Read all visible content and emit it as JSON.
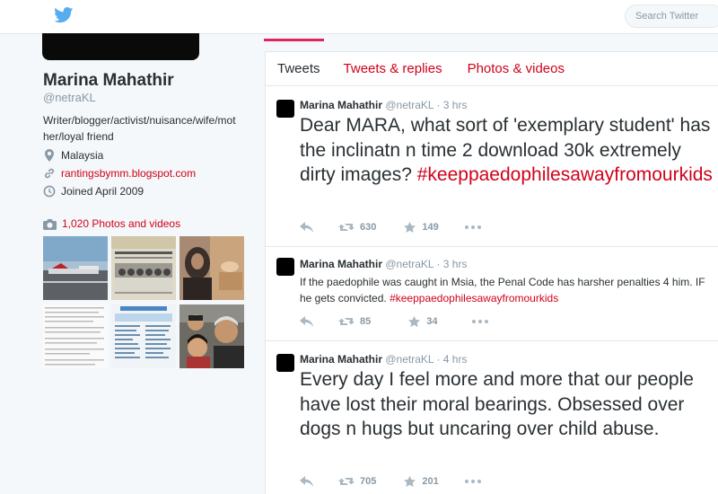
{
  "search": {
    "placeholder": "Search Twitter"
  },
  "profile": {
    "name": "Marina Mahathir",
    "handle": "@netraKL",
    "bio": "Writer/blogger/activist/nuisance/wife/mother/loyal friend",
    "location": "Malaysia",
    "url": "rantingsbymm.blogspot.com",
    "joined": "Joined April 2009",
    "photos_label": "1,020 Photos and videos"
  },
  "tabs": [
    {
      "label": "Tweets"
    },
    {
      "label": "Tweets & replies"
    },
    {
      "label": "Photos & videos"
    }
  ],
  "tweets": [
    {
      "name": "Marina Mahathir",
      "handle": "@netraKL",
      "time": "· 3 hrs",
      "text": "Dear MARA, what sort of 'exemplary student' has the inclinatn n time 2 download 30k extremely dirty images?",
      "hashtag": "#keeppaedophilesawayfromourkids",
      "retweets": "630",
      "likes": "149"
    },
    {
      "name": "Marina Mahathir",
      "handle": "@netraKL",
      "time": "· 3 hrs",
      "text": "If the paedophile was caught in Msia, the Penal Code has harsher penalties 4 him. IF he gets convicted.",
      "hashtag": "#keeppaedophilesawayfromourkids",
      "retweets": "85",
      "likes": "34"
    },
    {
      "name": "Marina Mahathir",
      "handle": "@netraKL",
      "time": "· 4 hrs",
      "text": "Every day I feel more and more that our people have lost their moral bearings. Obsessed over dogs n hugs but uncaring over child abuse.",
      "retweets": "705",
      "likes": "201"
    }
  ],
  "colors": {
    "accent": "#d0021b",
    "twitter_blue": "#55acee",
    "muted": "#8899a6"
  }
}
